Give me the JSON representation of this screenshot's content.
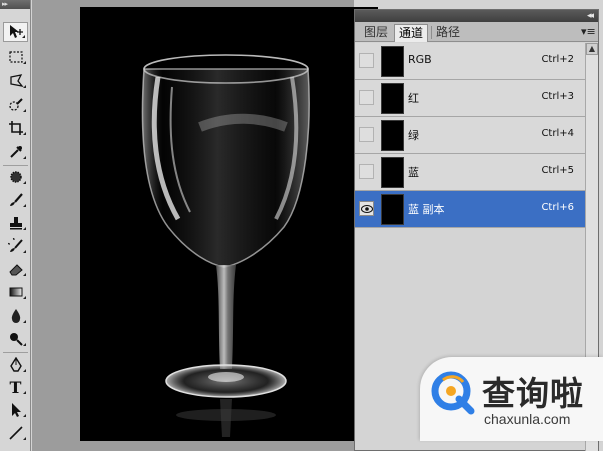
{
  "tools": [
    {
      "name": "move-tool-icon",
      "selected": true
    },
    {
      "name": "marquee-tool-icon"
    },
    {
      "name": "lasso-tool-icon"
    },
    {
      "name": "quick-selection-tool-icon"
    },
    {
      "name": "crop-tool-icon"
    },
    {
      "name": "eyedropper-tool-icon"
    },
    {
      "name": "spot-healing-tool-icon"
    },
    {
      "name": "brush-tool-icon"
    },
    {
      "name": "clone-stamp-tool-icon"
    },
    {
      "name": "history-brush-tool-icon"
    },
    {
      "name": "eraser-tool-icon"
    },
    {
      "name": "gradient-tool-icon"
    },
    {
      "name": "blur-tool-icon"
    },
    {
      "name": "dodge-tool-icon"
    },
    {
      "name": "pen-tool-icon"
    },
    {
      "name": "type-tool-icon",
      "glyph": "T"
    },
    {
      "name": "path-selection-tool-icon"
    },
    {
      "name": "line-tool-icon"
    }
  ],
  "panel": {
    "tabs": [
      {
        "label": "图层",
        "active": false
      },
      {
        "label": "通道",
        "active": true
      },
      {
        "label": "路径",
        "active": false
      }
    ],
    "channels": [
      {
        "name": "RGB",
        "shortcut": "Ctrl+2",
        "visible": false,
        "selected": false
      },
      {
        "name": "红",
        "shortcut": "Ctrl+3",
        "visible": false,
        "selected": false
      },
      {
        "name": "绿",
        "shortcut": "Ctrl+4",
        "visible": false,
        "selected": false
      },
      {
        "name": "蓝",
        "shortcut": "Ctrl+5",
        "visible": false,
        "selected": false
      },
      {
        "name": "蓝 副本",
        "shortcut": "Ctrl+6",
        "visible": true,
        "selected": true
      }
    ]
  },
  "colors": {
    "selection": "#3b6fc4",
    "watermark_brand": "#2f7fe6",
    "watermark_accent": "#f5a623"
  },
  "watermark": {
    "title": "查询啦",
    "url": "chaxunla.com"
  }
}
